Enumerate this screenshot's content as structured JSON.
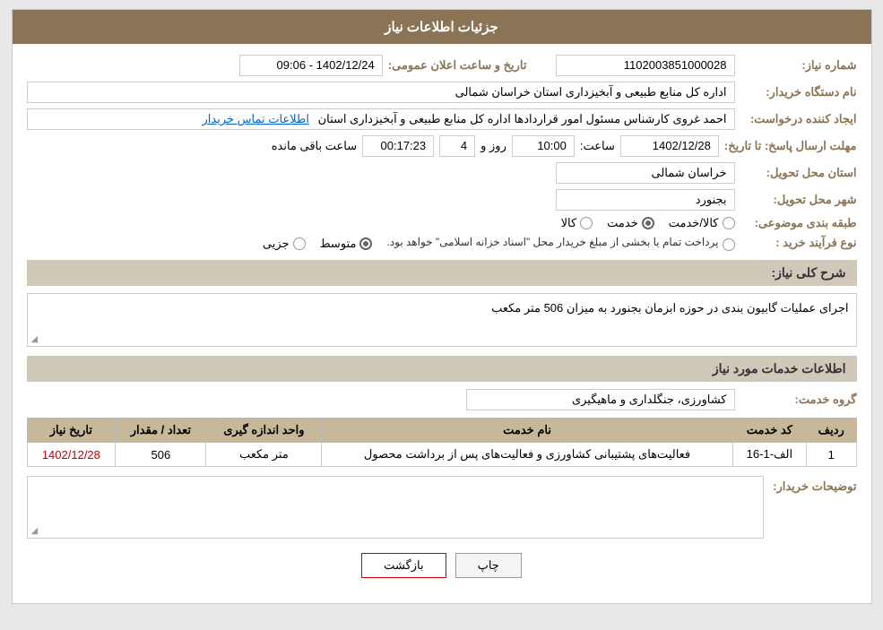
{
  "header": {
    "title": "جزئیات اطلاعات نیاز"
  },
  "fields": {
    "need_number_label": "شماره نیاز:",
    "need_number_value": "1102003851000028",
    "public_announce_label": "تاریخ و ساعت اعلان عمومی:",
    "public_announce_value": "1402/12/24 - 09:06",
    "buyer_org_label": "نام دستگاه خریدار:",
    "buyer_org_value": "اداره کل منابع طبیعی و آبخیزداری استان خراسان شمالی",
    "creator_label": "ایجاد کننده درخواست:",
    "creator_value": "احمد غروی کارشناس مسئول امور قراردادها اداره کل منابع طبیعی و آبخیزداری استان",
    "contact_link": "اطلاعات تماس خریدار",
    "deadline_label": "مهلت ارسال پاسخ: تا تاریخ:",
    "deadline_date": "1402/12/28",
    "deadline_time_label": "ساعت:",
    "deadline_time": "10:00",
    "deadline_days_label": "روز و",
    "deadline_days": "4",
    "remaining_label": "ساعت باقی مانده",
    "remaining_time": "00:17:23",
    "province_label": "استان محل تحویل:",
    "province_value": "خراسان شمالی",
    "city_label": "شهر محل تحویل:",
    "city_value": "بجنورد",
    "category_label": "طبقه بندی موضوعی:",
    "category_options": [
      "کالا",
      "خدمت",
      "کالا/خدمت"
    ],
    "category_selected": "خدمت",
    "purchase_type_label": "نوع فرآیند خرید :",
    "purchase_type_options": [
      "جزیی",
      "متوسط",
      "پرداخت تمام یا بخشی از مبلغ خریدار محل \"اسناد خزانه اسلامی\" خواهد بود."
    ],
    "purchase_type_selected": "متوسط",
    "purchase_type_note": "پرداخت تمام یا بخشی از مبلغ خریدار محل \"اسناد خزانه اسلامی\" خواهد بود.",
    "description_label": "شرح کلی نیاز:",
    "description_value": "اجرای عملیات گابیون بندی در حوزه ابزمان بجنورد به میزان 506 متر مکعب",
    "services_section_label": "اطلاعات خدمات مورد نیاز",
    "service_group_label": "گروه خدمت:",
    "service_group_value": "کشاورزی، جنگلداری و ماهیگیری",
    "table": {
      "headers": [
        "ردیف",
        "کد خدمت",
        "نام خدمت",
        "واحد اندازه گیری",
        "تعداد / مقدار",
        "تاریخ نیاز"
      ],
      "rows": [
        {
          "row": "1",
          "code": "الف-1-16",
          "name": "فعالیت‌های پشتیبانی کشاورزی و فعالیت‌های پس از برداشت محصول",
          "unit": "متر مکعب",
          "quantity": "506",
          "date": "1402/12/28"
        }
      ]
    },
    "buyer_notes_label": "توضیحات خریدار:",
    "buyer_notes_value": ""
  },
  "buttons": {
    "print_label": "چاپ",
    "back_label": "بازگشت"
  }
}
